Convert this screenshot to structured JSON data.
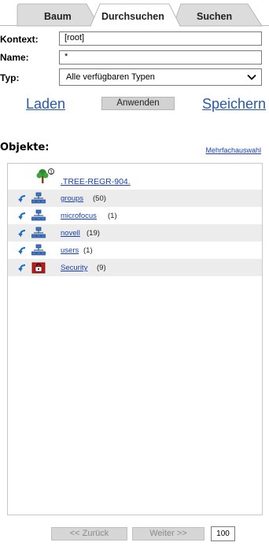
{
  "tabs": [
    {
      "label": "Baum",
      "active": false
    },
    {
      "label": "Durchsuchen",
      "active": true
    },
    {
      "label": "Suchen",
      "active": false
    }
  ],
  "form": {
    "context_label": "Kontext:",
    "context_value": "[root]",
    "name_label": "Name:",
    "name_value": "*",
    "type_label": "Typ:",
    "type_value": "Alle verfügbaren Typen"
  },
  "actions": {
    "load_label": "Laden",
    "apply_label": "Anwenden",
    "save_label": "Speichern"
  },
  "objects": {
    "title": "Objekte:",
    "multi_select_label": "Mehrfachauswahl",
    "root": {
      "name": ".TREE-REGR-904.",
      "badge": "①"
    },
    "items": [
      {
        "name": "groups",
        "count": "(50)",
        "icon": "org-unit-icon"
      },
      {
        "name": "microfocus",
        "count": "(1)",
        "icon": "org-unit-icon"
      },
      {
        "name": "novell",
        "count": "(19)",
        "icon": "org-unit-icon"
      },
      {
        "name": "users",
        "count": "(1)",
        "icon": "org-unit-icon"
      },
      {
        "name": "Security",
        "count": "(9)",
        "icon": "security-container-icon"
      }
    ]
  },
  "pager": {
    "prev_label": "<< Zurück",
    "next_label": "Weiter >>",
    "page_size": "100"
  },
  "colors": {
    "link": "#1a3fb0",
    "big_link": "#2a5aa0",
    "row_alt": "#ececec",
    "button_bg": "#d2d2d2"
  }
}
